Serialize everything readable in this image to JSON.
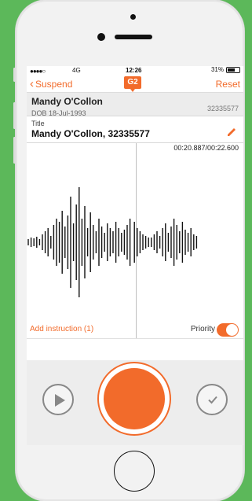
{
  "status_bar": {
    "signal": "●●●●○",
    "network": "4G",
    "time": "12:26",
    "battery": "31%"
  },
  "nav": {
    "back_label": "Suspend",
    "logo": "G2",
    "reset_label": "Reset"
  },
  "patient": {
    "name": "Mandy O'Collon",
    "dob": "DOB 18-Jul-1993",
    "id": "32335577"
  },
  "title": {
    "label": "Title",
    "value": "Mandy O'Collon, 32335577"
  },
  "recording": {
    "timer": "00:20.887/00:22.600"
  },
  "footer": {
    "instruction_label": "Add instruction (1)",
    "priority_label": "Priority",
    "priority_on": true
  },
  "colors": {
    "accent": "#f26b2b",
    "background": "#5cb85a"
  },
  "icons": {
    "back": "chevron-left-icon",
    "edit": "pencil-icon",
    "play": "play-icon",
    "record": "record-icon",
    "done": "checkmark-icon"
  }
}
